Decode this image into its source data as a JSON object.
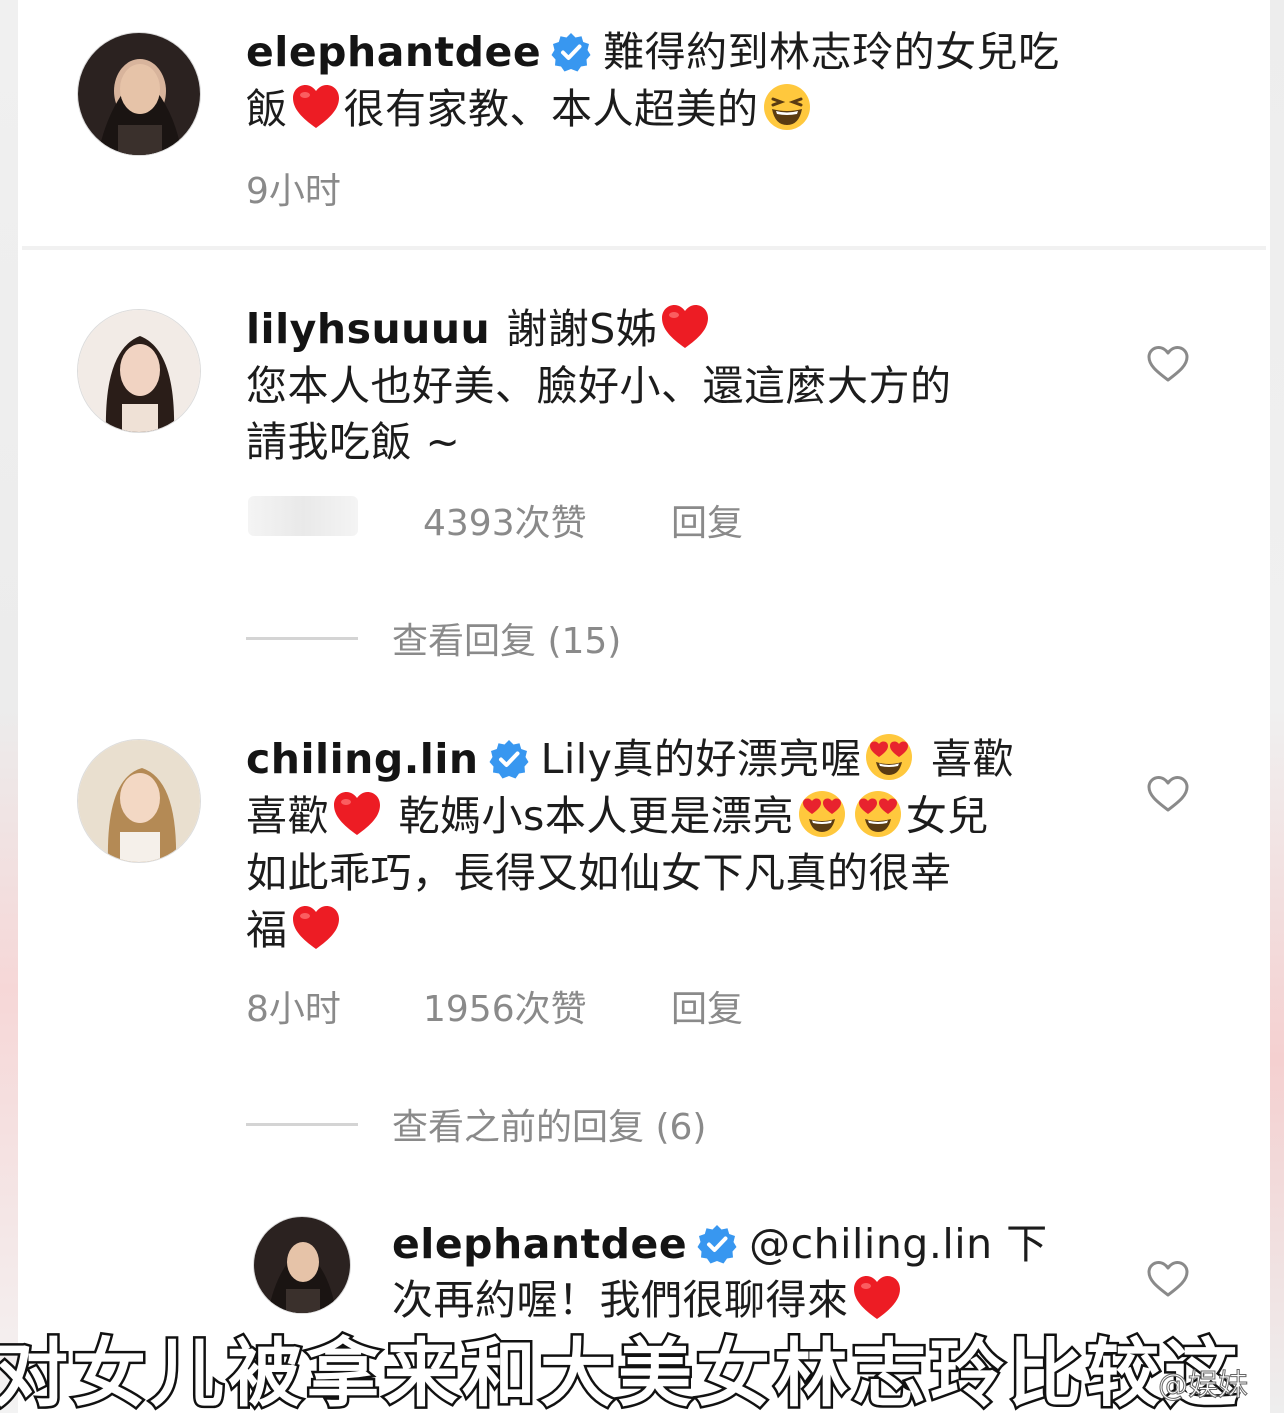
{
  "comments": [
    {
      "username": "elephantdee",
      "verified": true,
      "line1": "難得約到林志玲的女兒吃",
      "line2_a": "飯",
      "line2_b": "很有家教、本人超美的",
      "time": "9小时"
    },
    {
      "username": "lilyhsuuuu",
      "verified": false,
      "line1": "謝謝S姊",
      "line2": "您本人也好美、臉好小、還這麼大方的",
      "line3": "請我吃飯 ~",
      "likes": "4393次赞",
      "reply": "回复",
      "view_replies": "查看回复 (15)"
    },
    {
      "username": "chiling.lin",
      "verified": true,
      "line1_a": "Lily真的好漂亮喔",
      "line1_b": " 喜歡",
      "line2_a": "喜歡",
      "line2_b": " 乾媽小s本人更是漂亮",
      "line2_c": "女兒",
      "line3": "如此乖巧，長得又如仙女下凡真的很幸",
      "line4": "福",
      "time": "8小时",
      "likes": "1956次赞",
      "reply": "回复",
      "view_replies": "查看之前的回复 (6)"
    },
    {
      "username": "elephantdee",
      "verified": true,
      "line1": "@chiling.lin 下",
      "line2": "次再約喔！我們很聊得來"
    }
  ],
  "subtitle": "对女儿被拿来和大美女林志玲比较这",
  "watermark": "@娱妹",
  "icons": {
    "verified": "verified-badge-icon",
    "heart": "heart-emoji",
    "like": "heart-outline-icon",
    "laugh": "grinning-squinting-emoji",
    "heart_eyes": "heart-eyes-emoji"
  },
  "colors": {
    "verified_blue": "#3897f0",
    "heart_red": "#ed1c24",
    "meta_gray": "#8a8a8a"
  }
}
